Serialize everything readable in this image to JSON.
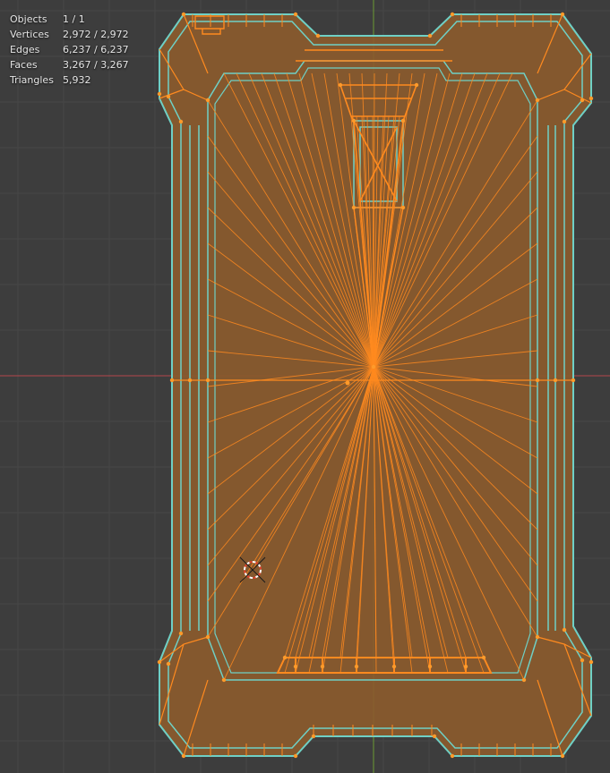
{
  "viewport": {
    "background": "#3d3d3d",
    "grid_color": "#4a4a4a",
    "x_axis_color": "#b5474c",
    "y_axis_color": "#6a9a34",
    "mesh_fill": "#8a5a2c",
    "edge_color": "#ff8a1f",
    "seam_color": "#6fd0c5",
    "cursor_icon": "3d-cursor-icon"
  },
  "stats": [
    {
      "label": "Objects",
      "value": "1 / 1"
    },
    {
      "label": "Vertices",
      "value": "2,972 / 2,972"
    },
    {
      "label": "Edges",
      "value": "6,237 / 6,237"
    },
    {
      "label": "Faces",
      "value": "3,267 / 3,267"
    },
    {
      "label": "Triangles",
      "value": "5,932"
    }
  ]
}
